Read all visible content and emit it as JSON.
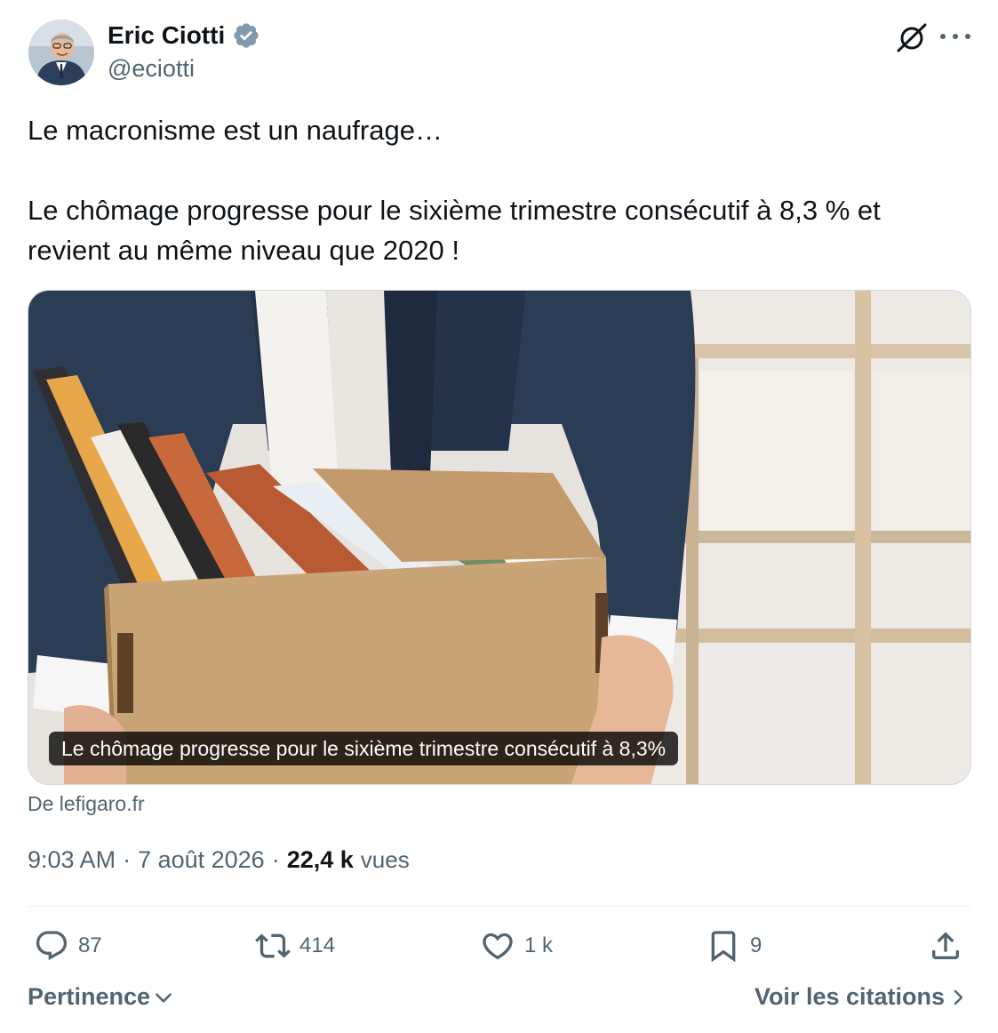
{
  "author": {
    "name": "Eric Ciotti",
    "handle": "@eciotti",
    "verified_color": "#829aab"
  },
  "tweet": {
    "paragraphs": [
      "Le macronisme est un naufrage…",
      "Le chômage progresse pour le sixième trimestre consécutif à 8,3 % et revient au même niveau que 2020 !"
    ]
  },
  "card": {
    "caption": "Le chômage progresse pour le sixième trimestre consécutif à 8,3%",
    "source": "De lefigaro.fr"
  },
  "meta": {
    "time": "9:03 AM",
    "separator": "·",
    "date": "7 août 2026",
    "views_count": "22,4 k",
    "views_label": "vues"
  },
  "actions": {
    "replies": "87",
    "retweets": "414",
    "likes": "1 k",
    "bookmarks": "9"
  },
  "footer": {
    "sort_label": "Pertinence",
    "quotes_label": "Voir les citations"
  },
  "icons": [
    "grok-icon",
    "more-icon",
    "verified-badge-icon",
    "reply-icon",
    "retweet-icon",
    "like-icon",
    "bookmark-icon",
    "share-icon",
    "chevron-down-icon",
    "chevron-right-icon"
  ],
  "colors": {
    "text_primary": "#0f1419",
    "text_secondary": "#536471",
    "divider": "#eff3f4"
  }
}
